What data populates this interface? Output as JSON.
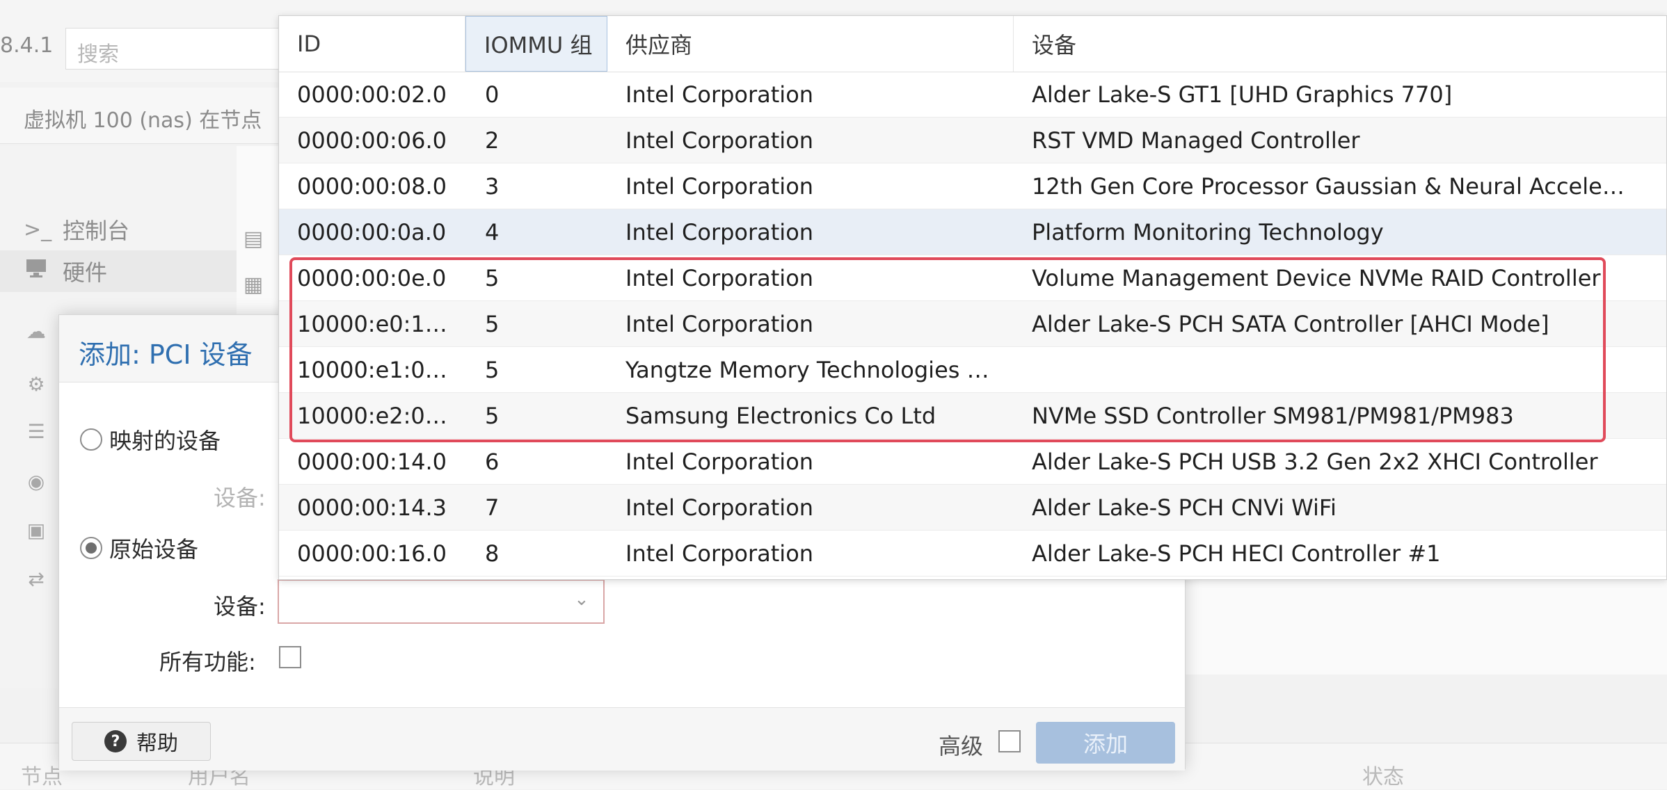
{
  "app": {
    "version_fragment": "8.4.1",
    "search_placeholder": "搜索",
    "vm_title": "虚拟机 100 (nas) 在节点"
  },
  "nav": {
    "items": [
      {
        "label": "控制台",
        "icon": "terminal-icon"
      },
      {
        "label": "硬件",
        "icon": "monitor-icon"
      }
    ]
  },
  "dialog": {
    "title": "添加: PCI 设备",
    "mapped_label": "映射的设备",
    "mapped_device_label": "设备:",
    "raw_label": "原始设备",
    "device_label": "设备:",
    "all_functions_label": "所有功能:",
    "help_label": "帮助",
    "advanced_label": "高级",
    "add_label": "添加"
  },
  "table": {
    "columns": {
      "id": "ID",
      "iommu": "IOMMU 组",
      "vendor": "供应商",
      "device": "设备"
    },
    "rows": [
      {
        "id": "0000:00:02.0",
        "iommu": "0",
        "vendor": "Intel Corporation",
        "device": "Alder Lake-S GT1 [UHD Graphics 770]"
      },
      {
        "id": "0000:00:06.0",
        "iommu": "2",
        "vendor": "Intel Corporation",
        "device": "RST VMD Managed Controller"
      },
      {
        "id": "0000:00:08.0",
        "iommu": "3",
        "vendor": "Intel Corporation",
        "device": "12th Gen Core Processor Gaussian & Neural Accele…"
      },
      {
        "id": "0000:00:0a.0",
        "iommu": "4",
        "vendor": "Intel Corporation",
        "device": "Platform Monitoring Technology"
      },
      {
        "id": "0000:00:0e.0",
        "iommu": "5",
        "vendor": "Intel Corporation",
        "device": "Volume Management Device NVMe RAID Controller"
      },
      {
        "id": "10000:e0:1…",
        "iommu": "5",
        "vendor": "Intel Corporation",
        "device": "Alder Lake-S PCH SATA Controller [AHCI Mode]"
      },
      {
        "id": "10000:e1:0…",
        "iommu": "5",
        "vendor": "Yangtze Memory Technologies …",
        "device": ""
      },
      {
        "id": "10000:e2:0…",
        "iommu": "5",
        "vendor": "Samsung Electronics Co Ltd",
        "device": "NVMe SSD Controller SM981/PM981/PM983"
      },
      {
        "id": "0000:00:14.0",
        "iommu": "6",
        "vendor": "Intel Corporation",
        "device": "Alder Lake-S PCH USB 3.2 Gen 2x2 XHCI Controller"
      },
      {
        "id": "0000:00:14.3",
        "iommu": "7",
        "vendor": "Intel Corporation",
        "device": "Alder Lake-S PCH CNVi WiFi"
      },
      {
        "id": "0000:00:16.0",
        "iommu": "8",
        "vendor": "Intel Corporation",
        "device": "Alder Lake-S PCH HECI Controller #1"
      }
    ]
  },
  "bottom": {
    "col_node": "节点",
    "col_user": "用户名",
    "col_desc": "说明",
    "col_status": "状态"
  },
  "colors": {
    "accent": "#2f6fb0",
    "highlight": "#e04a5a",
    "add_button_disabled": "#a7c0de"
  }
}
